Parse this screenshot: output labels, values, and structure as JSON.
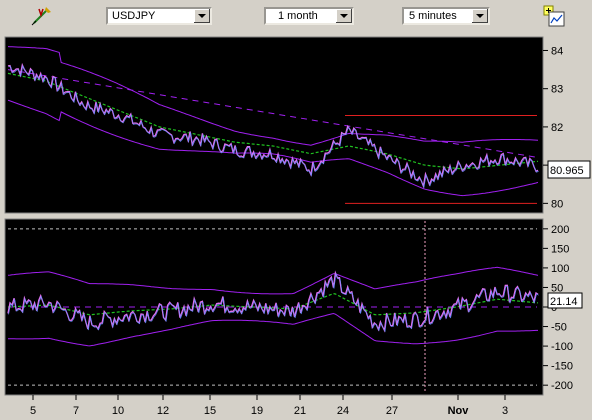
{
  "toolbar": {
    "symbol": "USDJPY",
    "range": "1 month",
    "interval": "5 minutes",
    "drawing_tool_icon": "pencil-cursor-icon",
    "add_chart_icon": "add-chart-icon"
  },
  "price_panel": {
    "last_value_label": "80.965",
    "y_ticks": [
      "84",
      "83",
      "82",
      "81",
      "80"
    ]
  },
  "indicator_panel": {
    "last_value_label": "21.14",
    "y_ticks": [
      "200",
      "150",
      "100",
      "50",
      "0",
      "-50",
      "-100",
      "-150",
      "-200"
    ]
  },
  "x_axis": {
    "ticks": [
      "5",
      "7",
      "10",
      "12",
      "15",
      "19",
      "21",
      "24",
      "27",
      "Nov",
      "3"
    ]
  },
  "colors": {
    "panel_bg": "#000000",
    "price_line": "#e070f0",
    "bollinger": "#a020f0",
    "moving_average": "#20c020",
    "reference_line": "#e02020"
  },
  "chart_data": [
    {
      "type": "line",
      "title": "",
      "series": [
        {
          "name": "",
          "values": [
            83.6,
            83.3,
            82.6,
            82.3,
            81.8,
            81.7,
            81.4,
            81.3,
            80.9,
            81.9,
            81.2,
            80.6,
            81.0,
            81.2,
            80.97
          ]
        },
        {
          "name": "",
          "values": [
            83.4,
            83.2,
            82.8,
            82.4,
            82.0,
            81.8,
            81.6,
            81.5,
            81.3,
            81.5,
            81.3,
            81.0,
            80.9,
            81.0,
            81.1
          ]
        }
      ],
      "x": [
        "5",
        "7",
        "10",
        "12",
        "15",
        "19",
        "21",
        "24",
        "27",
        "Nov",
        "3"
      ],
      "ylim": [
        79.8,
        84.3
      ],
      "reference_lines": [
        82.3,
        80.0
      ],
      "last_value": 80.965
    },
    {
      "type": "line",
      "title": "",
      "series": [
        {
          "name": "",
          "values": [
            0,
            10,
            -40,
            -20,
            -10,
            10,
            0,
            -10,
            70,
            -40,
            -30,
            0,
            40,
            21.14
          ]
        }
      ],
      "x": [
        "5",
        "7",
        "10",
        "12",
        "15",
        "19",
        "21",
        "24",
        "27",
        "Nov",
        "3"
      ],
      "ylim": [
        -220,
        220
      ],
      "reference_lines": [
        200,
        -200
      ],
      "last_value": 21.14
    }
  ]
}
